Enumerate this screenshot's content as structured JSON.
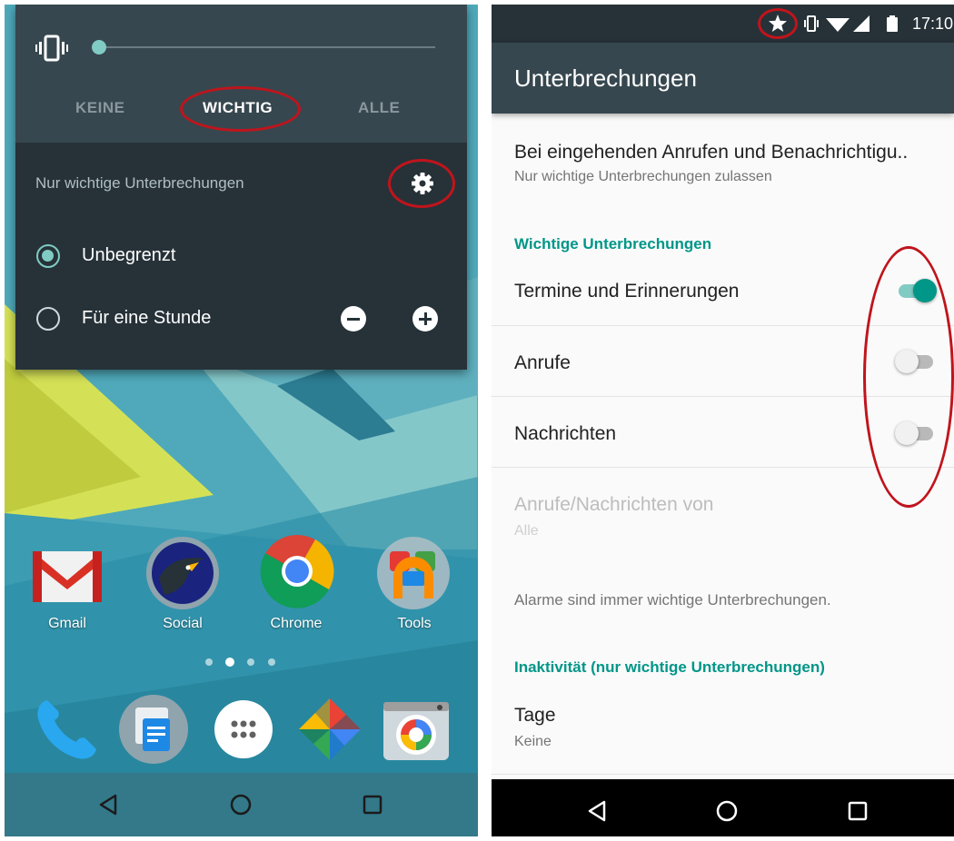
{
  "left_screen": {
    "quick_panel": {
      "modes": [
        {
          "label": "KEINE",
          "active": false
        },
        {
          "label": "WICHTIG",
          "active": true
        },
        {
          "label": "ALLE",
          "active": false
        }
      ],
      "subtitle": "Nur wichtige Unterbrechungen",
      "slider_level": 0.0,
      "options": [
        {
          "label": "Unbegrenzt",
          "selected": true
        },
        {
          "label": "Für eine Stunde",
          "selected": false
        }
      ],
      "icons": {
        "ringer": "vibrate-icon",
        "settings": "gear-icon",
        "decrease": "minus-circle-icon",
        "increase": "plus-circle-icon"
      }
    },
    "home_apps": [
      {
        "label": "Gmail",
        "icon": "gmail-icon"
      },
      {
        "label": "Social",
        "icon": "social-icon"
      },
      {
        "label": "Chrome",
        "icon": "chrome-icon"
      },
      {
        "label": "Tools",
        "icon": "tools-folder-icon"
      }
    ],
    "page_indicator": {
      "count": 4,
      "active_index": 1
    },
    "dock": [
      "phone-icon",
      "messenger-icon",
      "app-drawer-icon",
      "photos-icon",
      "camera-icon"
    ],
    "nav": [
      "back-icon",
      "home-icon",
      "recents-icon"
    ]
  },
  "right_screen": {
    "status_bar": {
      "time": "17:10",
      "icons": [
        "star-icon",
        "vibrate-icon",
        "wifi-icon",
        "signal-icon",
        "battery-icon"
      ]
    },
    "app_bar_title": "Unterbrechungen",
    "incoming_setting": {
      "title": "Bei eingehenden Anrufen und Benachrichtigu..",
      "summary": "Nur wichtige Unterbrechungen zulassen"
    },
    "section_priority": "Wichtige Unterbrechungen",
    "toggles": [
      {
        "label": "Termine und Erinnerungen",
        "on": true
      },
      {
        "label": "Anrufe",
        "on": false
      },
      {
        "label": "Nachrichten",
        "on": false
      }
    ],
    "from_setting": {
      "title": "Anrufe/Nachrichten von",
      "value": "Alle"
    },
    "alarm_note": "Alarme sind immer wichtige Unterbrechungen.",
    "section_downtime": "Inaktivität (nur wichtige Unterbrechungen)",
    "days_setting": {
      "title": "Tage",
      "value": "Keine"
    },
    "nav": [
      "back-icon",
      "home-icon",
      "recents-icon"
    ]
  },
  "colors": {
    "accent_teal": "#009688",
    "annotation_red": "#c0141c",
    "panel_dark": "#263238",
    "appbar_dark": "#37474f"
  }
}
